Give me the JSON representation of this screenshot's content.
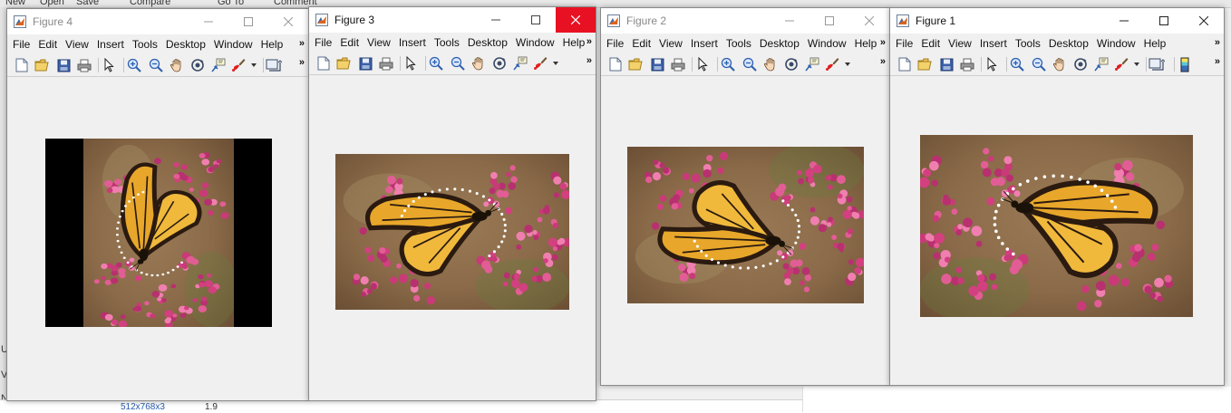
{
  "desktop": {
    "top_items": [
      "New",
      "Open",
      "Save",
      "Compare",
      "Go To",
      "Comment"
    ],
    "left_items": [
      "U",
      "V",
      "N"
    ],
    "bottom_value": "512x768x3",
    "bottom_number": "1.9"
  },
  "menu_items": [
    "File",
    "Edit",
    "View",
    "Insert",
    "Tools",
    "Desktop",
    "Window",
    "Help"
  ],
  "windows": [
    {
      "title": "Figure 4"
    },
    {
      "title": "Figure 3"
    },
    {
      "title": "Figure 2"
    },
    {
      "title": "Figure 1"
    }
  ],
  "menu_more": "»",
  "toolbar_more": "»",
  "colors": {
    "close_hover": "#e81123",
    "window_bg": "#f0f0f0",
    "flower_pink": "#d2407f",
    "wing_orange": "#e8a72a",
    "wing_border": "#2a1a10",
    "bg_brown": "#8a6a48"
  },
  "icons": [
    "new-figure-icon",
    "open-file-icon",
    "save-icon",
    "print-icon",
    "pointer-icon",
    "zoom-in-icon",
    "zoom-out-icon",
    "pan-icon",
    "rotate-3d-icon",
    "data-cursor-icon",
    "brush-icon",
    "link-plot-icon",
    "colorbar-icon"
  ]
}
